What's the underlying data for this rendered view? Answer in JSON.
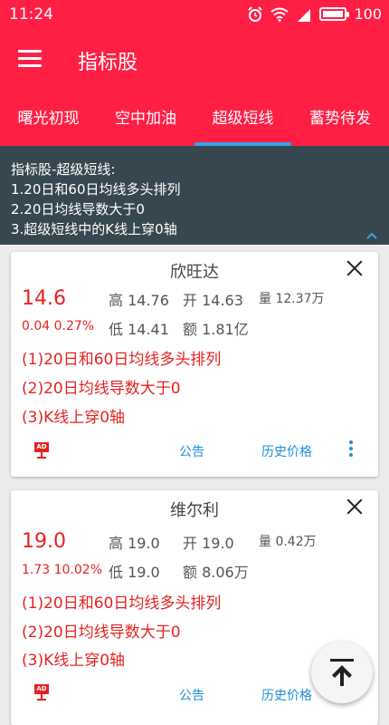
{
  "status": {
    "time": "11:24",
    "battery": "100"
  },
  "appbar": {
    "title": "指标股"
  },
  "tabs": [
    "曙光初现",
    "空中加油",
    "超级短线",
    "蓄势待发"
  ],
  "active_tab": 2,
  "info": {
    "line1": "指标股-超级短线:",
    "line2": "1.20日和60日均线多头排列",
    "line3": "2.20日均线导数大于0",
    "line4": "3.超级短线中的K线上穿0轴"
  },
  "cards": [
    {
      "name": "欣旺达",
      "price": "14.6",
      "change": "0.04 0.27%",
      "high": "高 14.76",
      "open": "开 14.63",
      "volume": "量 12.37万",
      "low": "低 14.41",
      "amount": "额 1.81亿",
      "cond1": "(1)20日和60日均线多头排列",
      "cond2": "(2)20日均线导数大于0",
      "cond3": "(3)K线上穿0轴",
      "notice": "公告",
      "history": "历史价格"
    },
    {
      "name": "维尔利",
      "price": "19.0",
      "change": "1.73 10.02%",
      "high": "高 19.0",
      "open": "开 19.0",
      "volume": "量 0.42万",
      "low": "低 19.0",
      "amount": "额 8.06万",
      "cond1": "(1)20日和60日均线多头排列",
      "cond2": "(2)20日均线导数大于0",
      "cond3": "(3)K线上穿0轴",
      "notice": "公告",
      "history": "历史价格"
    }
  ],
  "ad_label": "AD",
  "colors": {
    "brand": "#ff1f45",
    "up": "#e52222",
    "link": "#1a8fd8",
    "info_bg": "#37474f"
  },
  "icons": [
    "alarm-icon",
    "wifi-icon",
    "signal-icon",
    "battery-icon",
    "menu-icon",
    "close-icon",
    "ad-icon",
    "more-vert-icon",
    "scroll-top-icon"
  ]
}
